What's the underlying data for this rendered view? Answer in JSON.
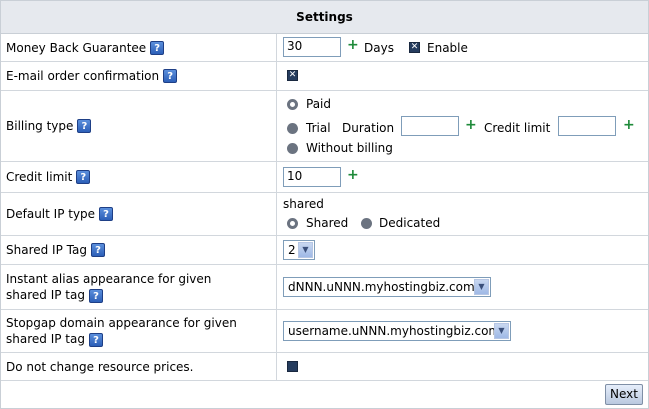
{
  "header": {
    "title": "Settings"
  },
  "rows": {
    "money_back": {
      "label": "Money Back Guarantee",
      "value": "30",
      "unit": "Days",
      "enable_label": "Enable"
    },
    "email_confirm": {
      "label": "E-mail order confirmation"
    },
    "billing": {
      "label": "Billing type",
      "opt_paid": "Paid",
      "opt_trial": "Trial",
      "duration_label": "Duration",
      "credit_label": "Credit limit",
      "opt_without": "Without billing",
      "selected": "Paid"
    },
    "credit_limit": {
      "label": "Credit limit",
      "value": "10"
    },
    "default_ip": {
      "label": "Default IP type",
      "current": "shared",
      "opt_shared": "Shared",
      "opt_dedicated": "Dedicated",
      "selected": "Shared"
    },
    "shared_ip_tag": {
      "label": "Shared IP Tag",
      "value": "2"
    },
    "instant_alias": {
      "label_line1": "Instant alias appearance for given",
      "label_line2": "shared IP tag",
      "value": "dNNN.uNNN.myhostingbiz.com"
    },
    "stopgap": {
      "label_line1": "Stopgap domain appearance for given",
      "label_line2": "shared IP tag",
      "value": "username.uNNN.myhostingbiz.com"
    },
    "resource_prices": {
      "label": "Do not change resource prices."
    }
  },
  "footer": {
    "next_label": "Next"
  },
  "icons": {
    "help": "?",
    "plus": "+"
  }
}
